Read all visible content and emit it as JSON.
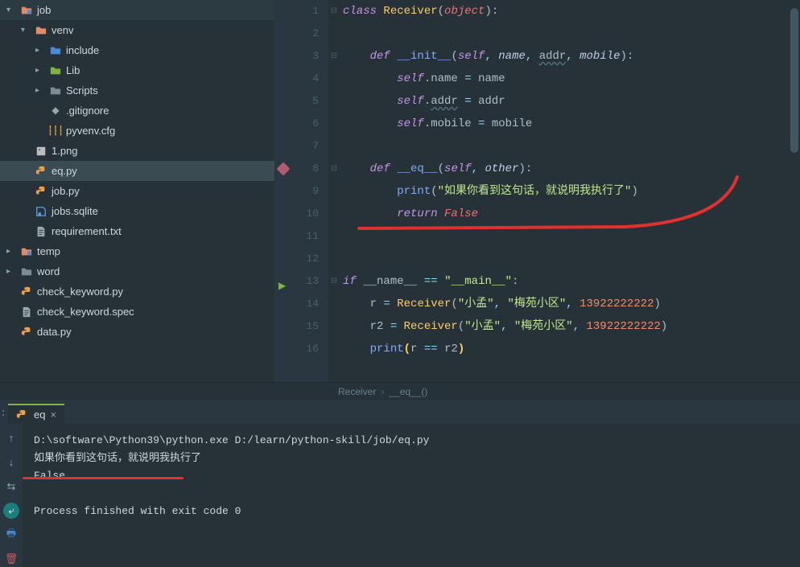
{
  "sidebar": {
    "items": [
      {
        "label": "job",
        "indent": 0,
        "chevron": "down",
        "iconType": "folder-e",
        "selected": false
      },
      {
        "label": "venv",
        "indent": 1,
        "chevron": "down",
        "iconType": "folder",
        "selected": false
      },
      {
        "label": "include",
        "indent": 2,
        "chevron": "right",
        "iconType": "folder-py",
        "selected": false
      },
      {
        "label": "Lib",
        "indent": 2,
        "chevron": "right",
        "iconType": "folder-lib",
        "selected": false
      },
      {
        "label": "Scripts",
        "indent": 2,
        "chevron": "right",
        "iconType": "folder-gray",
        "selected": false
      },
      {
        "label": ".gitignore",
        "indent": 2,
        "chevron": "",
        "iconType": "git",
        "selected": false
      },
      {
        "label": "pyvenv.cfg",
        "indent": 2,
        "chevron": "",
        "iconType": "cfg",
        "selected": false
      },
      {
        "label": "1.png",
        "indent": 1,
        "chevron": "",
        "iconType": "img",
        "selected": false
      },
      {
        "label": "eq.py",
        "indent": 1,
        "chevron": "",
        "iconType": "py",
        "selected": true
      },
      {
        "label": "job.py",
        "indent": 1,
        "chevron": "",
        "iconType": "py",
        "selected": false
      },
      {
        "label": "jobs.sqlite",
        "indent": 1,
        "chevron": "",
        "iconType": "db",
        "selected": false
      },
      {
        "label": "requirement.txt",
        "indent": 1,
        "chevron": "",
        "iconType": "txt",
        "selected": false
      },
      {
        "label": "temp",
        "indent": 0,
        "chevron": "right",
        "iconType": "folder-e",
        "selected": false
      },
      {
        "label": "word",
        "indent": 0,
        "chevron": "right",
        "iconType": "folder-gray",
        "selected": false
      },
      {
        "label": "check_keyword.py",
        "indent": 0,
        "chevron": "",
        "iconType": "py",
        "selected": false
      },
      {
        "label": "check_keyword.spec",
        "indent": 0,
        "chevron": "",
        "iconType": "txt",
        "selected": false
      },
      {
        "label": "data.py",
        "indent": 0,
        "chevron": "",
        "iconType": "py",
        "selected": false
      }
    ]
  },
  "editor": {
    "lines": [
      {
        "n": 1,
        "fold": "-",
        "tokens": [
          [
            "kw",
            "class "
          ],
          [
            "cls",
            "Receiver"
          ],
          [
            "txt",
            "("
          ],
          [
            "builtin",
            "object"
          ],
          [
            "txt",
            "):"
          ]
        ]
      },
      {
        "n": 2,
        "fold": "",
        "tokens": []
      },
      {
        "n": 3,
        "fold": "-",
        "tokens": [
          [
            "txt",
            "    "
          ],
          [
            "kw",
            "def "
          ],
          [
            "fn",
            "__init__"
          ],
          [
            "txt",
            "("
          ],
          [
            "self",
            "self"
          ],
          [
            "op",
            ", "
          ],
          [
            "param",
            "name"
          ],
          [
            "op",
            ", "
          ],
          [
            "param-u",
            "addr"
          ],
          [
            "op",
            ", "
          ],
          [
            "param",
            "mobile"
          ],
          [
            "txt",
            "):"
          ]
        ]
      },
      {
        "n": 4,
        "fold": "",
        "tokens": [
          [
            "txt",
            "        "
          ],
          [
            "self",
            "self"
          ],
          [
            "txt",
            ".name "
          ],
          [
            "op",
            "= "
          ],
          [
            "txt",
            "name"
          ]
        ]
      },
      {
        "n": 5,
        "fold": "",
        "tokens": [
          [
            "txt",
            "        "
          ],
          [
            "self",
            "self"
          ],
          [
            "txt",
            "."
          ],
          [
            "param-u",
            "addr"
          ],
          [
            "txt",
            " "
          ],
          [
            "op",
            "= "
          ],
          [
            "txt",
            "addr"
          ]
        ]
      },
      {
        "n": 6,
        "fold": "",
        "tokens": [
          [
            "txt",
            "        "
          ],
          [
            "self",
            "self"
          ],
          [
            "txt",
            ".mobile "
          ],
          [
            "op",
            "= "
          ],
          [
            "txt",
            "mobile"
          ]
        ]
      },
      {
        "n": 7,
        "fold": "",
        "tokens": []
      },
      {
        "n": 8,
        "fold": "-",
        "tokens": [
          [
            "txt",
            "    "
          ],
          [
            "kw",
            "def "
          ],
          [
            "fn",
            "__eq__"
          ],
          [
            "txt",
            "("
          ],
          [
            "self",
            "self"
          ],
          [
            "op",
            ", "
          ],
          [
            "param",
            "other"
          ],
          [
            "txt",
            "):"
          ]
        ],
        "bp": true
      },
      {
        "n": 9,
        "fold": "",
        "tokens": [
          [
            "txt",
            "        "
          ],
          [
            "fn",
            "print"
          ],
          [
            "txt",
            "("
          ],
          [
            "str",
            "\"如果你看到这句话，就说明我执行了\""
          ],
          [
            "txt",
            ")"
          ]
        ]
      },
      {
        "n": 10,
        "fold": "",
        "tokens": [
          [
            "txt",
            "        "
          ],
          [
            "kw",
            "return "
          ],
          [
            "builtin",
            "False"
          ]
        ]
      },
      {
        "n": 11,
        "fold": "",
        "tokens": []
      },
      {
        "n": 12,
        "fold": "",
        "tokens": []
      },
      {
        "n": 13,
        "fold": "-",
        "tokens": [
          [
            "kw",
            "if "
          ],
          [
            "txt",
            "__name__ "
          ],
          [
            "op",
            "== "
          ],
          [
            "str",
            "\"__main__\""
          ],
          [
            "txt",
            ":"
          ]
        ],
        "run": true
      },
      {
        "n": 14,
        "fold": "",
        "tokens": [
          [
            "txt",
            "    r "
          ],
          [
            "op",
            "= "
          ],
          [
            "cls",
            "Receiver"
          ],
          [
            "txt",
            "("
          ],
          [
            "str",
            "\"小孟\""
          ],
          [
            "op",
            ", "
          ],
          [
            "str",
            "\"梅苑小区\""
          ],
          [
            "op",
            ", "
          ],
          [
            "num",
            "13922222222"
          ],
          [
            "txt",
            ")"
          ]
        ]
      },
      {
        "n": 15,
        "fold": "",
        "tokens": [
          [
            "txt",
            "    r2 "
          ],
          [
            "op",
            "= "
          ],
          [
            "cls",
            "Receiver"
          ],
          [
            "txt",
            "("
          ],
          [
            "str",
            "\"小孟\""
          ],
          [
            "op",
            ", "
          ],
          [
            "str",
            "\"梅苑小区\""
          ],
          [
            "op",
            ", "
          ],
          [
            "num",
            "13922222222"
          ],
          [
            "txt",
            ")"
          ]
        ]
      },
      {
        "n": 16,
        "fold": "",
        "tokens": [
          [
            "txt",
            "    "
          ],
          [
            "fn",
            "print"
          ],
          [
            "paren",
            "("
          ],
          [
            "txt",
            "r "
          ],
          [
            "op",
            "== "
          ],
          [
            "txt",
            "r2"
          ],
          [
            "paren",
            ")"
          ]
        ]
      }
    ]
  },
  "breadcrumb": {
    "path": [
      "Receiver",
      "__eq__()"
    ]
  },
  "runTab": {
    "label": "eq"
  },
  "console": {
    "lines": [
      "D:\\software\\Python39\\python.exe D:/learn/python-skill/job/eq.py",
      "如果你看到这句话，就说明我执行了",
      "False",
      "",
      "Process finished with exit code 0"
    ]
  }
}
